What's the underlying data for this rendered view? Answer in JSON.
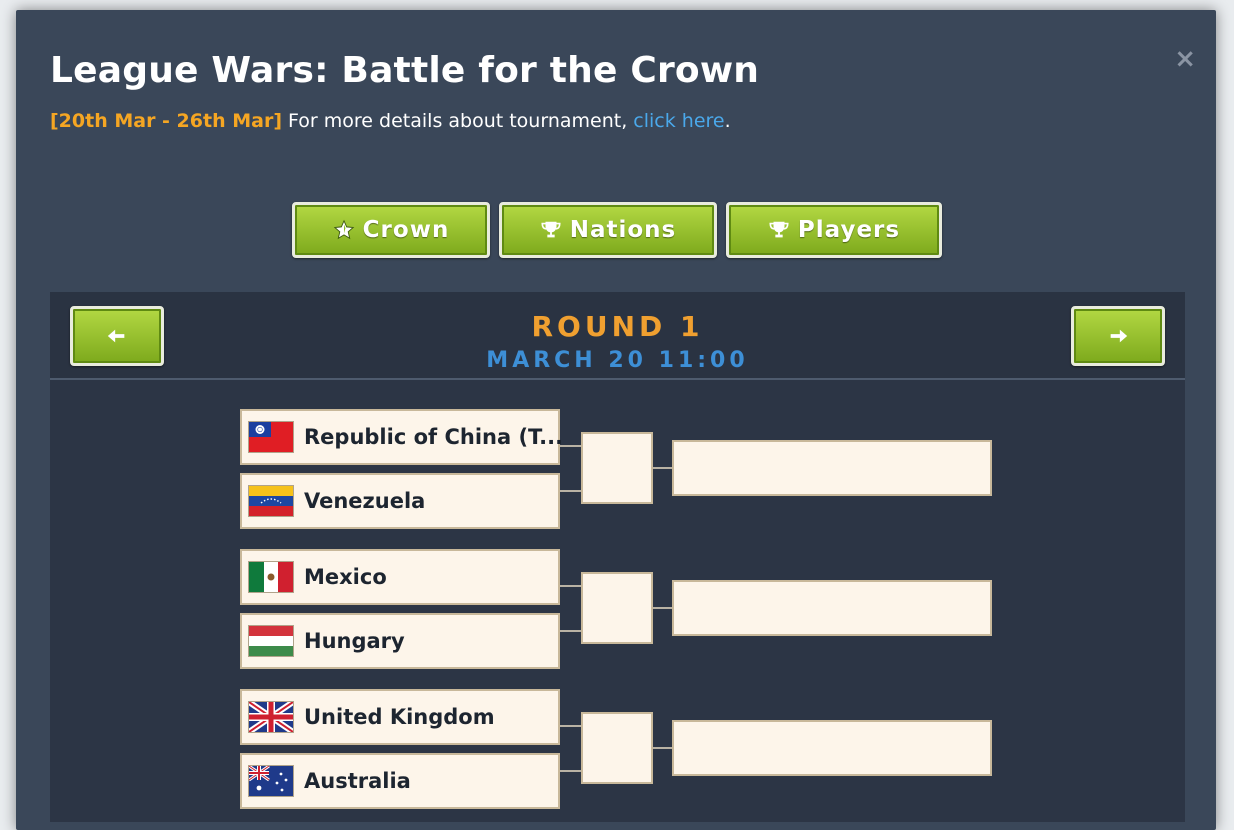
{
  "modal": {
    "title": "League Wars: Battle for the Crown",
    "date_range": "[20th Mar - 26th Mar]",
    "details_text": " For more details about tournament, ",
    "link_text": "click here",
    "link_suffix": ".",
    "close_label": "×"
  },
  "tabs": [
    {
      "label": "Crown",
      "icon": "star-icon"
    },
    {
      "label": "Nations",
      "icon": "trophy-icon"
    },
    {
      "label": "Players",
      "icon": "trophy-icon"
    }
  ],
  "round": {
    "title": "ROUND 1",
    "date": "MARCH 20 11:00",
    "prev_icon": "arrow-left-icon",
    "next_icon": "arrow-right-icon"
  },
  "matches": [
    {
      "team_a": {
        "name": "Republic of China (T...",
        "flag": "taiwan-flag-icon"
      },
      "team_b": {
        "name": "Venezuela",
        "flag": "venezuela-flag-icon"
      }
    },
    {
      "team_a": {
        "name": "Mexico",
        "flag": "mexico-flag-icon"
      },
      "team_b": {
        "name": "Hungary",
        "flag": "hungary-flag-icon"
      }
    },
    {
      "team_a": {
        "name": "United Kingdom",
        "flag": "uk-flag-icon"
      },
      "team_b": {
        "name": "Australia",
        "flag": "australia-flag-icon"
      }
    }
  ],
  "colors": {
    "modal_bg": "#3a4759",
    "panel_bg": "#2c3545",
    "accent_orange": "#f0a030",
    "accent_blue": "#3d8fd6",
    "button_green": "#8fbf26",
    "slot_bg": "#fdf5ea"
  }
}
